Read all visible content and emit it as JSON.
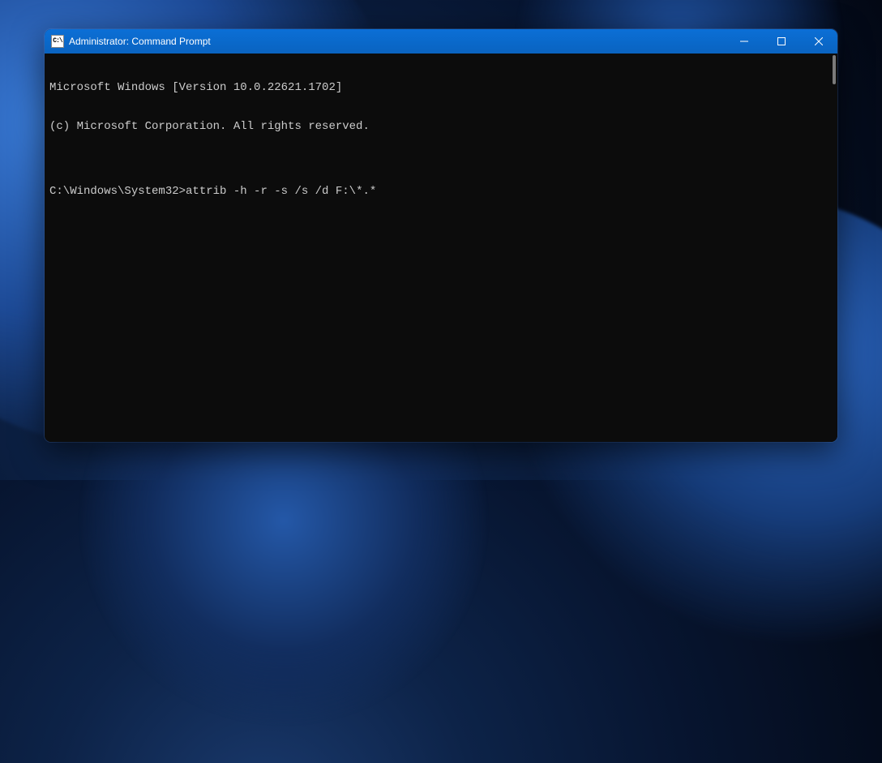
{
  "window": {
    "title": "Administrator: Command Prompt",
    "icon_label": "C:\\"
  },
  "terminal": {
    "line1": "Microsoft Windows [Version 10.0.22621.1702]",
    "line2": "(c) Microsoft Corporation. All rights reserved.",
    "blank": "",
    "prompt": "C:\\Windows\\System32>",
    "command": "attrib -h -r -s /s /d F:\\*.*"
  }
}
